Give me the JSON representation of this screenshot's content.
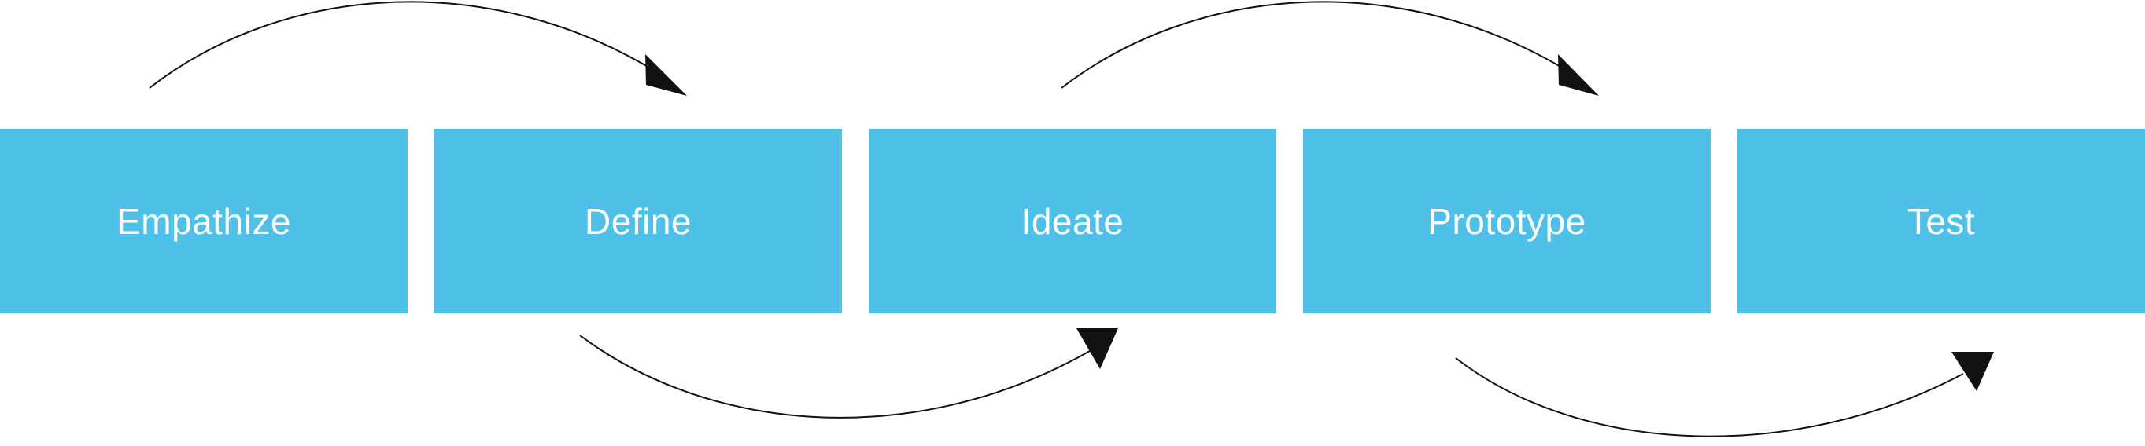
{
  "diagram": {
    "box_color": "#4FC0E8",
    "label_color": "#FFFFFF",
    "arrow_color": "#111111",
    "stages": [
      {
        "label": "Empathize"
      },
      {
        "label": "Define"
      },
      {
        "label": "Ideate"
      },
      {
        "label": "Prototype"
      },
      {
        "label": "Test"
      }
    ],
    "connections": [
      {
        "from": "Empathize",
        "to": "Define",
        "side": "top"
      },
      {
        "from": "Define",
        "to": "Ideate",
        "side": "bottom"
      },
      {
        "from": "Ideate",
        "to": "Prototype",
        "side": "top"
      },
      {
        "from": "Prototype",
        "to": "Test",
        "side": "bottom"
      }
    ]
  }
}
